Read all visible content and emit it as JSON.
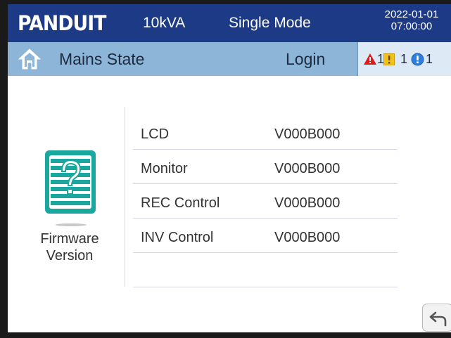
{
  "header": {
    "brand": "PANDUIT",
    "capacity": "10kVA",
    "mode": "Single Mode",
    "date": "2022-01-01",
    "time": "07:00:00"
  },
  "statusbar": {
    "home_icon": "home-icon",
    "state_label": "Mains State",
    "login_label": "Login",
    "alarms": [
      {
        "icon": "fault-triangle-icon",
        "count": "1",
        "color": "#e01a1a"
      },
      {
        "icon": "warning-square-icon",
        "count": "1",
        "color": "#f3c21a"
      },
      {
        "icon": "info-circle-icon",
        "count": "1",
        "color": "#2f7fe0"
      }
    ]
  },
  "main": {
    "section_icon": "firmware-version-icon",
    "section_label_line1": "Firmware",
    "section_label_line2": "Version",
    "rows": [
      {
        "name": "LCD",
        "version": "V000B000"
      },
      {
        "name": "Monitor",
        "version": "V000B000"
      },
      {
        "name": "REC Control",
        "version": "V000B000"
      },
      {
        "name": "INV Control",
        "version": "V000B000"
      },
      {
        "name": "",
        "version": ""
      }
    ],
    "back_icon": "back-arrow-icon"
  },
  "colors": {
    "header_bg": "#1d3a86",
    "statusbar_bg": "#8cb5d8",
    "accent_teal": "#1aa7a0"
  }
}
